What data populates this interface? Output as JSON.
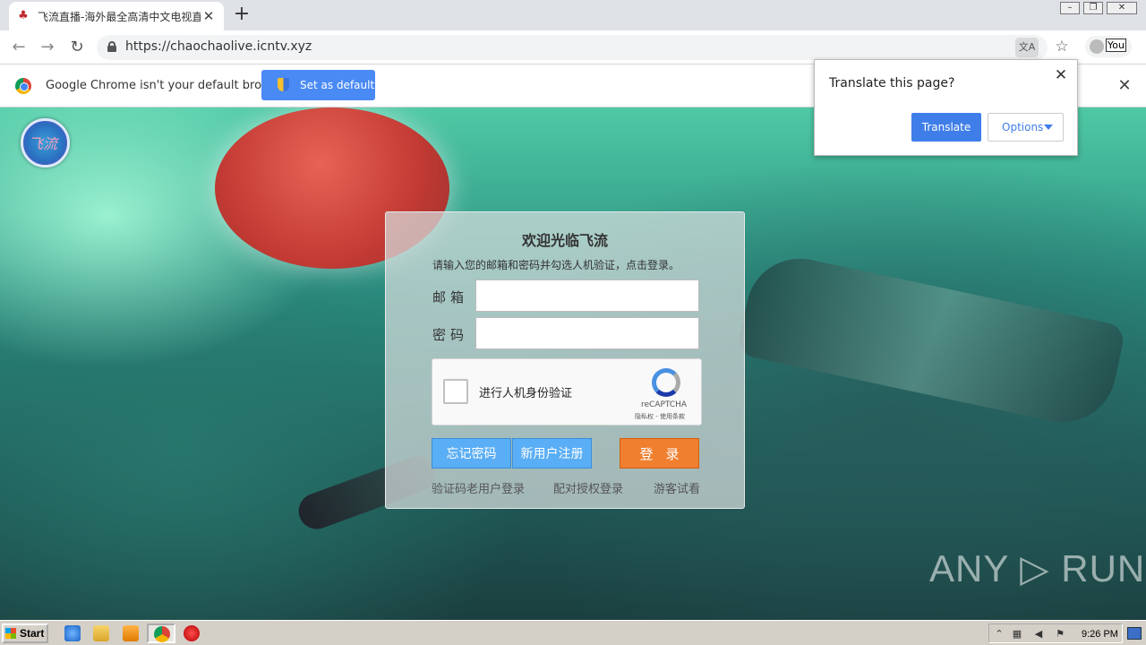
{
  "browser": {
    "tab_title": "飞流直播-海外最全高清中文电视直播",
    "tab_close": "✕",
    "new_tab": "+",
    "url": "https://chaochaolive.icntv.xyz",
    "profile_label": "You",
    "window_controls": [
      "–",
      "❐",
      "✕"
    ]
  },
  "infobar": {
    "message": "Google Chrome isn't your default browser",
    "button_label": "Set as default",
    "close": "✕"
  },
  "translate_popup": {
    "title": "Translate this page?",
    "translate_label": "Translate",
    "options_label": "Options",
    "close": "✕"
  },
  "login": {
    "title": "欢迎光临飞流",
    "subtitle": "请输入您的邮箱和密码并勾选人机验证，点击登录。",
    "email_label": "邮箱",
    "password_label": "密码",
    "captcha_label": "进行人机身份验证",
    "recaptcha_brand": "reCAPTCHA",
    "recaptcha_links": "隐私权 - 使用条款",
    "forgot_label": "忘记密码",
    "register_label": "新用户注册",
    "login_label": "登录",
    "link_sms": "验证码老用户登录",
    "link_pair": "配对授权登录",
    "link_guest": "游客试看"
  },
  "watermark": "ANY ▷ RUN",
  "taskbar": {
    "start_label": "Start",
    "clock": "9:26 PM"
  }
}
